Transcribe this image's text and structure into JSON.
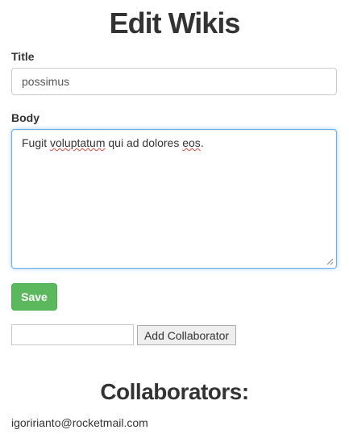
{
  "page": {
    "title": "Edit Wikis"
  },
  "form": {
    "title_label": "Title",
    "title_value": "possimus",
    "body_label": "Body",
    "body_parts": [
      "Fugit ",
      "voluptatum",
      " qui ad dolores ",
      "eos",
      "."
    ],
    "save_label": "Save"
  },
  "collaborator_form": {
    "input_value": "",
    "add_label": "Add Collaborator"
  },
  "collaborators": {
    "heading": "Collaborators:",
    "items": [
      "igoririanto@rocketmail.com"
    ]
  },
  "colors": {
    "accent_focus": "#66afe9",
    "save_green": "#5cb85c"
  }
}
